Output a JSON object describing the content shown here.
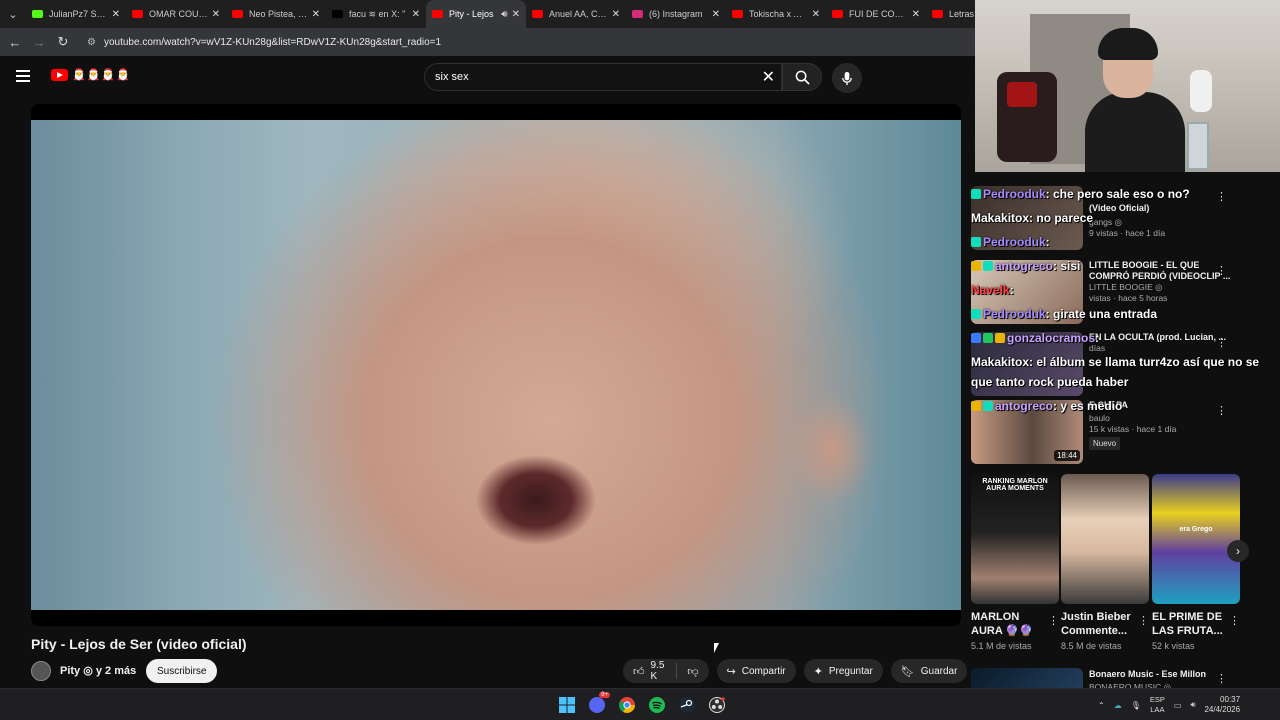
{
  "browser": {
    "tabs": [
      {
        "title": "JulianPz7 Strea",
        "color": "#53fc18"
      },
      {
        "title": "OMAR COURTZ",
        "color": "#ff0000"
      },
      {
        "title": "Neo Pistea, Ela",
        "color": "#ff0000"
      },
      {
        "title": "facu ≋ en X: \"",
        "color": "#000000"
      },
      {
        "title": "Pity - Lejos",
        "color": "#ff0000",
        "active": true
      },
      {
        "title": "Anuel AA, Cand",
        "color": "#ff0000"
      },
      {
        "title": "(6) Instagram",
        "color": "#d62976"
      },
      {
        "title": "Tokischa x Anu",
        "color": "#ff0000"
      },
      {
        "title": "FUI DE COMPR",
        "color": "#ff0000"
      },
      {
        "title": "Letras",
        "color": "#ff0000"
      }
    ],
    "url": "youtube.com/watch?v=wV1Z-KUn28g&list=RDwV1Z-KUn28g&start_radio=1"
  },
  "header": {
    "logo_text": "🎅🎅🎅🎅",
    "search_value": "six sex"
  },
  "video": {
    "title": "Pity - Lejos de Ser (video oficial)",
    "channel": "Pity ◎ y 2 más",
    "subscribe_label": "Suscribirse",
    "likes": "9.5 K",
    "share_label": "Compartir",
    "ask_label": "Preguntar",
    "save_label": "Guardar"
  },
  "chat": [
    {
      "user": "Pedrooduk",
      "text": ": che pero sale eso o no?",
      "color": "#a58cff"
    },
    {
      "user": "Makakitox",
      "text": ": no parece",
      "color": "#ffffff"
    },
    {
      "user": "Pedrooduk",
      "text": ":",
      "color": "#a58cff"
    },
    {
      "user": "antogreco",
      "text": ": sisi",
      "color": "#c8a3ff"
    },
    {
      "user": "Navelk",
      "text": ":",
      "color": "#ff4040"
    },
    {
      "user": "Pedrooduk",
      "text": ": girate una entrada",
      "color": "#a58cff"
    },
    {
      "user": "gonzalocramos",
      "text": ":",
      "color": "#c8a3ff"
    },
    {
      "user": "Makakitox",
      "text": ": el álbum se llama turr4zo así que no se",
      "color": "#ffffff"
    },
    {
      "user": "",
      "text": "que tanto rock pueda haber",
      "color": "#ffffff"
    },
    {
      "user": "antogreco",
      "text": ": y es medio",
      "color": "#c8a3ff"
    }
  ],
  "recommendations": [
    {
      "title": "(Video Oficial)",
      "meta1": "gangs ◎",
      "meta2": "9 vistas · hace 1 día"
    },
    {
      "title": "LITTLE BOOGIE - EL QUE COMPRÓ PERDIÓ (VIDEOCLIP ...",
      "meta1": "LITTLE BOOGIE ◎",
      "meta2": "vistas · hace 5 horas"
    },
    {
      "title": "EN LA OCULTA (prod. Lucian, ...",
      "meta1": "",
      "meta2": "días"
    },
    {
      "title": "E CULPA",
      "meta1": "baulo",
      "meta2": "15 k vistas · hace 1 día",
      "badge": "Nuevo",
      "duration": "18:44"
    }
  ],
  "shorts": [
    {
      "title": "MARLON AURA 🔮🔮",
      "views": "5.1 M de vistas",
      "thumb_text": "RANKING MARLON AURA MOMENTS"
    },
    {
      "title": "Justin Bieber Commente...",
      "views": "8.5 M de vistas",
      "thumb_text": ""
    },
    {
      "title": "EL PRIME DE LAS FRUTA...",
      "views": "52 k vistas",
      "thumb_text": "era Grego"
    }
  ],
  "bottom_video": {
    "title": "Bonaero Music - Ese Millon",
    "channel": "BONAERO MUSIC ◎"
  },
  "taskbar": {
    "lang_top": "ESP",
    "lang_bottom": "LAA",
    "time": "00:37",
    "date": "24/4/2026",
    "discord_badge": "9+"
  }
}
